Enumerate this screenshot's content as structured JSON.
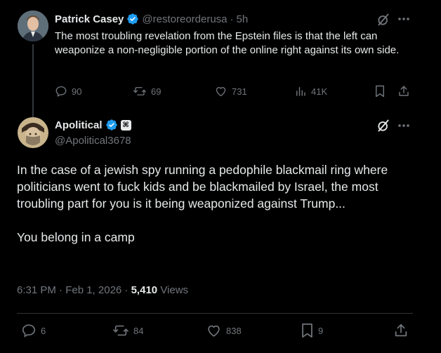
{
  "tweet1": {
    "name": "Patrick Casey",
    "handle": "@restoreorderusa",
    "separator": "·",
    "time": "5h",
    "text": "The most troubling revelation from the Epstein files is that the left can weaponize a non-negligible portion of the online right against its own side.",
    "actions": {
      "replies": "90",
      "reposts": "69",
      "likes": "731",
      "views": "41K"
    }
  },
  "tweet2": {
    "name": "Apolitical",
    "handle": "@Apolitical3678",
    "affiliate_badge": "⌘",
    "paragraph1": "In the case of a jewish spy running a pedophile blackmail ring where politicians went to fuck kids and be blackmailed by Israel, the most troubling part for you is it being weaponized against Trump...",
    "paragraph2": "You belong in a camp",
    "timestamp": "6:31 PM · Feb 1, 2026 · ",
    "views_count": "5,410",
    "views_label": "Views",
    "actions": {
      "replies": "6",
      "reposts": "84",
      "likes": "838",
      "bookmarks": "9"
    }
  },
  "colors": {
    "background": "#000000",
    "text": "#e7e9ea",
    "muted": "#71767b",
    "verified": "#1d9bf0",
    "divider": "#2f3336"
  },
  "icons": [
    "verified-badge-icon",
    "grok-icon",
    "more-icon",
    "reply-icon",
    "repost-icon",
    "like-icon",
    "views-icon",
    "bookmark-icon",
    "share-icon"
  ]
}
